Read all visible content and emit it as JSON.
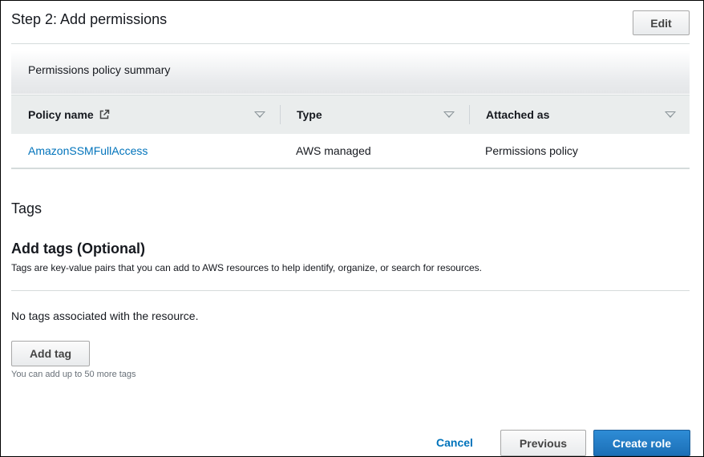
{
  "step": {
    "title": "Step 2: Add permissions",
    "edit_label": "Edit"
  },
  "permissions": {
    "summary_title": "Permissions policy summary",
    "columns": [
      "Policy name",
      "Type",
      "Attached as"
    ],
    "rows": [
      {
        "policy_name": "AmazonSSMFullAccess",
        "type": "AWS managed",
        "attached_as": "Permissions policy"
      }
    ]
  },
  "tags": {
    "section_title": "Tags",
    "add_title": "Add tags (Optional)",
    "description": "Tags are key-value pairs that you can add to AWS resources to help identify, organize, or search for resources.",
    "empty_message": "No tags associated with the resource.",
    "add_tag_label": "Add tag",
    "hint": "You can add up to 50 more tags"
  },
  "footer": {
    "cancel_label": "Cancel",
    "previous_label": "Previous",
    "create_label": "Create role"
  },
  "colors": {
    "link": "#0073bb",
    "primary_button": "#1c6fb6",
    "table_header": "#eaeded"
  },
  "icons": {
    "external_link": "external-link-icon",
    "sort": "caret-down-icon"
  }
}
